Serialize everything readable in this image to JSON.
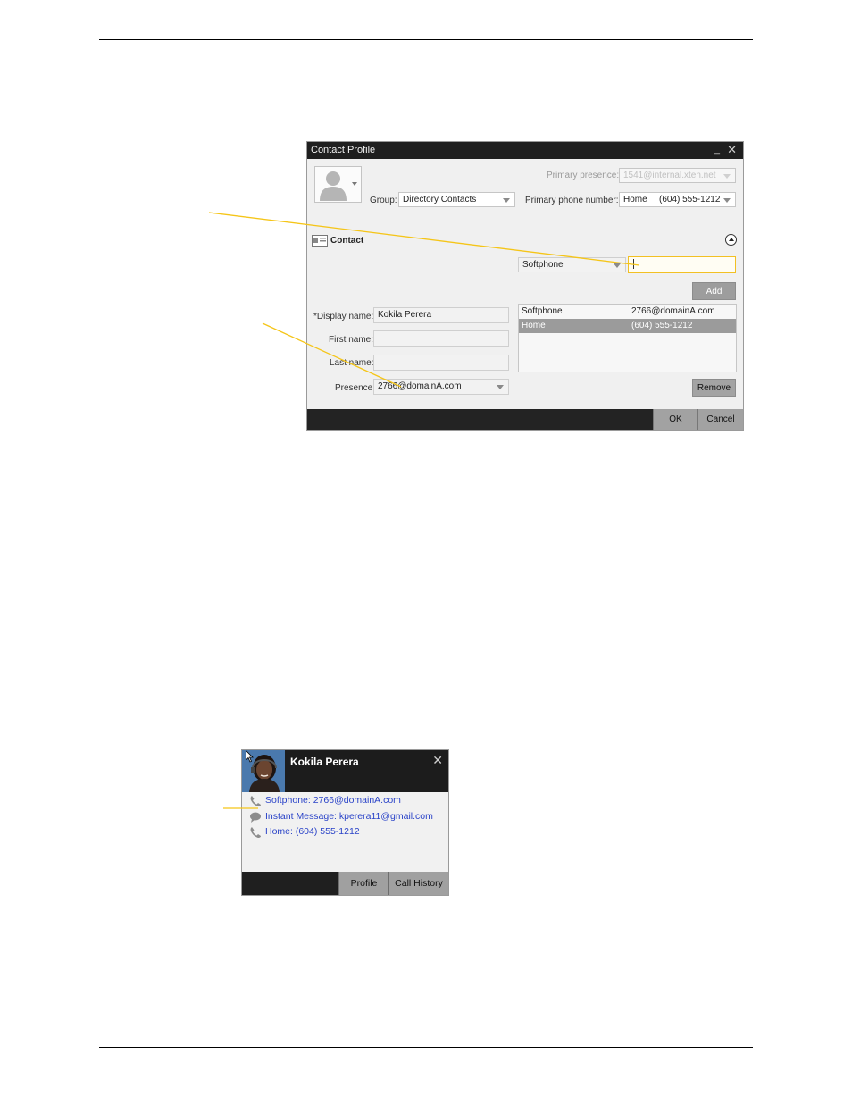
{
  "dialog": {
    "title": "Contact Profile",
    "minimize_glyph": "_",
    "close_glyph": "✕",
    "group_label": "Group:",
    "group_value": "Directory Contacts",
    "primary_presence_label": "Primary presence:",
    "primary_presence_value": "1541@internal.xten.net",
    "primary_phone_label": "Primary phone number:",
    "primary_phone_type": "Home",
    "primary_phone_number": "(604) 555-1212",
    "section_label": "Contact",
    "new_number_type": "Softphone",
    "new_number_value": "",
    "add_button": "Add",
    "display_name_label": "*Display name:",
    "display_name_value": "Kokila Perera",
    "first_name_label": "First name:",
    "first_name_value": "",
    "last_name_label": "Last name:",
    "last_name_value": "",
    "presence_label": "Presence:",
    "presence_value": "2766@domainA.com",
    "numbers": [
      {
        "type": "Softphone",
        "value": "2766@domainA.com",
        "selected": false
      },
      {
        "type": "Home",
        "value": "(604) 555-1212",
        "selected": true
      }
    ],
    "remove_button": "Remove",
    "ok_button": "OK",
    "cancel_button": "Cancel"
  },
  "card": {
    "name": "Kokila Perera",
    "close_glyph": "✕",
    "rows": [
      {
        "icon": "phone-icon",
        "text": "Softphone: 2766@domainA.com"
      },
      {
        "icon": "chat-bubble-icon",
        "text": "Instant Message: kperera11@gmail.com"
      },
      {
        "icon": "phone-icon",
        "text": "Home: (604) 555-1212"
      }
    ],
    "profile_button": "Profile",
    "call_history_button": "Call History"
  },
  "colors": {
    "callout": "#f5c518",
    "titlebar": "#1f1f1f",
    "button_gray": "#9d9d9d",
    "link_blue": "#2a43c8"
  }
}
